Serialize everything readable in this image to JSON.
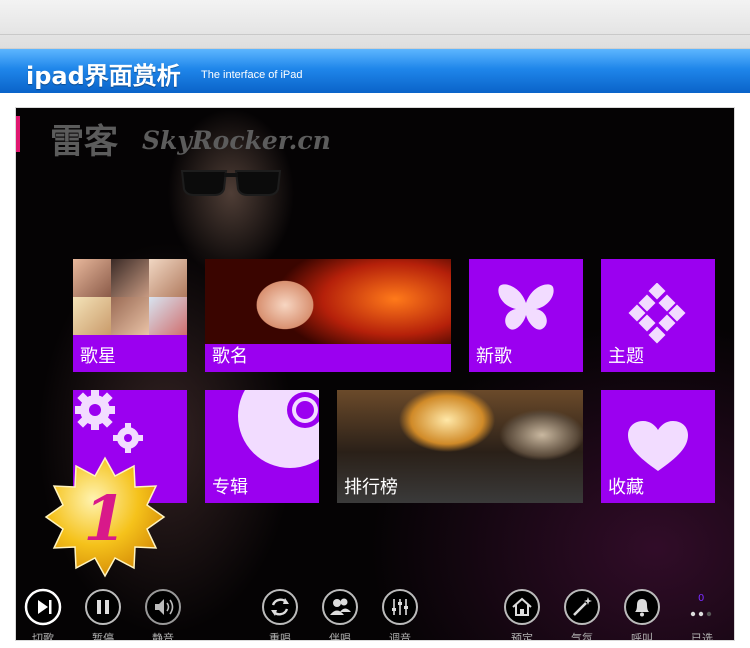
{
  "header": {
    "title": "ipad界面赏析",
    "subtitle": "The interface of iPad"
  },
  "app": {
    "brand_cn": "雷客",
    "brand_en": "SkyRocker.cn"
  },
  "tiles": [
    {
      "label": "歌星"
    },
    {
      "label": "歌名"
    },
    {
      "label": "新歌"
    },
    {
      "label": "主题"
    },
    {
      "label": ""
    },
    {
      "label": "专辑"
    },
    {
      "label": "排行榜"
    },
    {
      "label": "收藏"
    }
  ],
  "badge": {
    "number": "1"
  },
  "controls": [
    {
      "label": "切歌",
      "icon": "next-track-icon"
    },
    {
      "label": "暂停",
      "icon": "pause-icon"
    },
    {
      "label": "静音",
      "icon": "mute-icon"
    },
    {
      "label": "重唱",
      "icon": "replay-icon"
    },
    {
      "label": "伴唱",
      "icon": "accompany-icon"
    },
    {
      "label": "调音",
      "icon": "mixer-icon"
    },
    {
      "label": "预定",
      "icon": "home-icon"
    },
    {
      "label": "气氛",
      "icon": "magic-wand-icon"
    },
    {
      "label": "呼叫",
      "icon": "bell-icon"
    },
    {
      "label": "已选",
      "icon": "selected-dots-icon"
    }
  ],
  "selected_count": "0",
  "colors": {
    "tile": "#9b00f0",
    "banner": "#1f86ea",
    "accent": "#e0166f",
    "badge": "#f5c21b"
  }
}
